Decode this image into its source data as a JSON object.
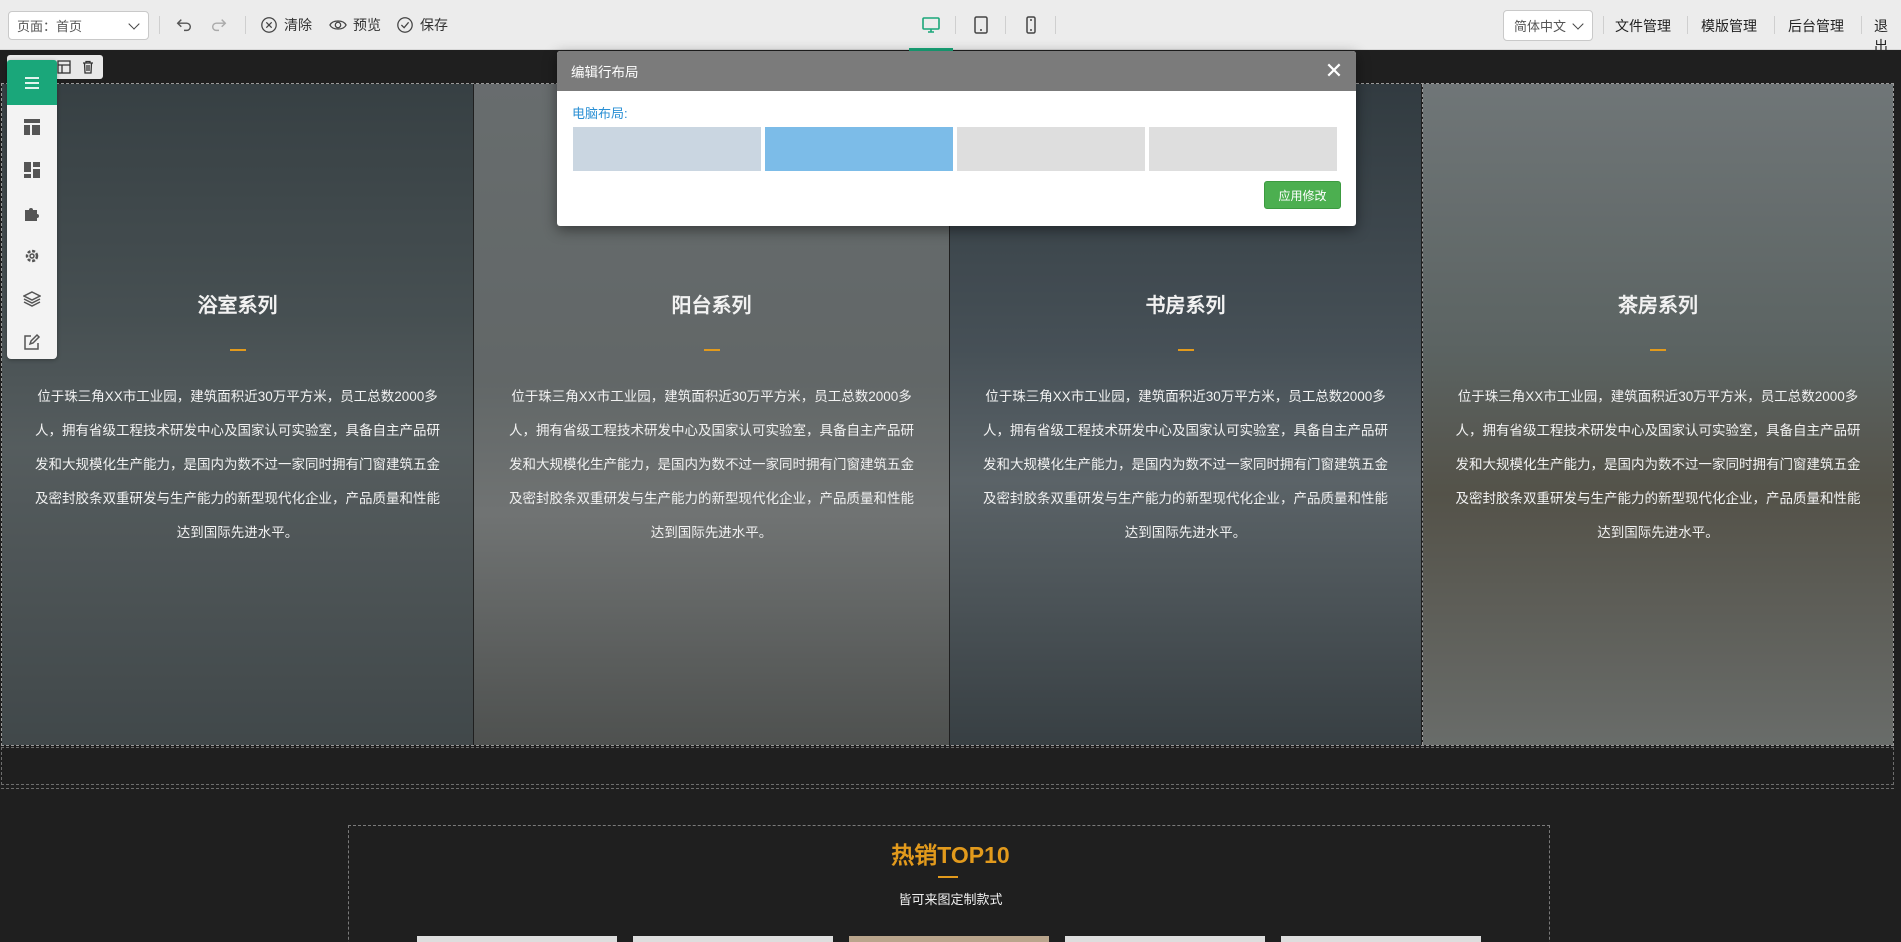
{
  "toolbar": {
    "page_select": "页面：首页",
    "clear_label": "清除",
    "preview_label": "预览",
    "save_label": "保存",
    "language": "简体中文",
    "links": [
      "文件管理",
      "模版管理",
      "后台管理",
      "退出"
    ]
  },
  "columns": [
    {
      "title": "浴室系列",
      "desc": "位于珠三角XX市工业园，建筑面积近30万平方米，员工总数2000多人，拥有省级工程技术研发中心及国家认可实验室，具备自主产品研发和大规模化生产能力，是国内为数不过一家同时拥有门窗建筑五金及密封胶条双重研发与生产能力的新型现代化企业，产品质量和性能达到国际先进水平。"
    },
    {
      "title": "阳台系列",
      "desc": "位于珠三角XX市工业园，建筑面积近30万平方米，员工总数2000多人，拥有省级工程技术研发中心及国家认可实验室，具备自主产品研发和大规模化生产能力，是国内为数不过一家同时拥有门窗建筑五金及密封胶条双重研发与生产能力的新型现代化企业，产品质量和性能达到国际先进水平。"
    },
    {
      "title": "书房系列",
      "desc": "位于珠三角XX市工业园，建筑面积近30万平方米，员工总数2000多人，拥有省级工程技术研发中心及国家认可实验室，具备自主产品研发和大规模化生产能力，是国内为数不过一家同时拥有门窗建筑五金及密封胶条双重研发与生产能力的新型现代化企业，产品质量和性能达到国际先进水平。"
    },
    {
      "title": "茶房系列",
      "desc": "位于珠三角XX市工业园，建筑面积近30万平方米，员工总数2000多人，拥有省级工程技术研发中心及国家认可实验室，具备自主产品研发和大规模化生产能力，是国内为数不过一家同时拥有门窗建筑五金及密封胶条双重研发与生产能力的新型现代化企业，产品质量和性能达到国际先进水平。"
    }
  ],
  "hot": {
    "title": "热销TOP10",
    "subtitle": "皆可来图定制款式"
  },
  "modal": {
    "title": "编辑行布局",
    "label": "电脑布局:",
    "close": "✕",
    "apply_label": "应用修改",
    "selected_option": 2
  },
  "colors": {
    "accent": "#1aa77a",
    "highlight": "#e29a1c",
    "link_blue": "#2a8fd4",
    "apply_green": "#4caf50"
  },
  "icons": [
    "undo-icon",
    "redo-icon",
    "clear-icon",
    "eye-icon",
    "check-circle-icon",
    "desktop-icon",
    "tablet-icon",
    "mobile-icon",
    "menu-icon",
    "layout-icon",
    "dashboard-icon",
    "puzzle-icon",
    "gear-icon",
    "layers-icon",
    "edit-icon",
    "grid-icon",
    "trash-icon"
  ]
}
